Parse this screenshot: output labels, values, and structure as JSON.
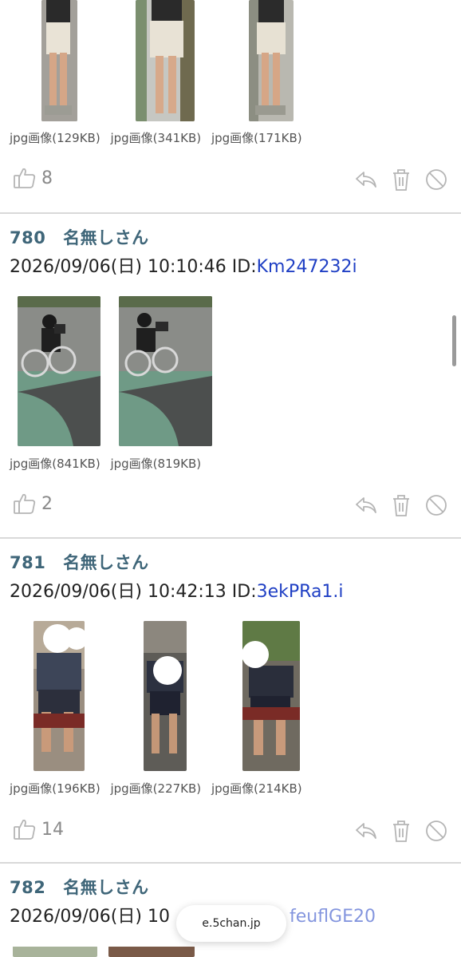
{
  "top_post": {
    "captions": [
      "jpg画像(129KB)",
      "jpg画像(341KB)",
      "jpg画像(171KB)"
    ],
    "likes": "8"
  },
  "post780": {
    "number": "780",
    "name": "名無しさん",
    "datetime": "2026/09/06(日) 10:10:46 ID:",
    "id": "Km247232i",
    "captions": [
      "jpg画像(841KB)",
      "jpg画像(819KB)"
    ],
    "likes": "2"
  },
  "post781": {
    "number": "781",
    "name": "名無しさん",
    "datetime": "2026/09/06(日) 10:42:13 ID:",
    "id": "3ekPRa1.i",
    "captions": [
      "jpg画像(196KB)",
      "jpg画像(227KB)",
      "jpg画像(214KB)"
    ],
    "likes": "14"
  },
  "post782": {
    "number": "782",
    "name": "名無しさん",
    "datetime_visible": "2026/09/06(日) 10",
    "id_partial": "feuflGE20"
  },
  "browser": {
    "url": "e.5chan.jp"
  },
  "colors": {
    "header": "#3f6679",
    "id_link": "#1f3fc4",
    "icon_gray": "#b5b5b5"
  }
}
